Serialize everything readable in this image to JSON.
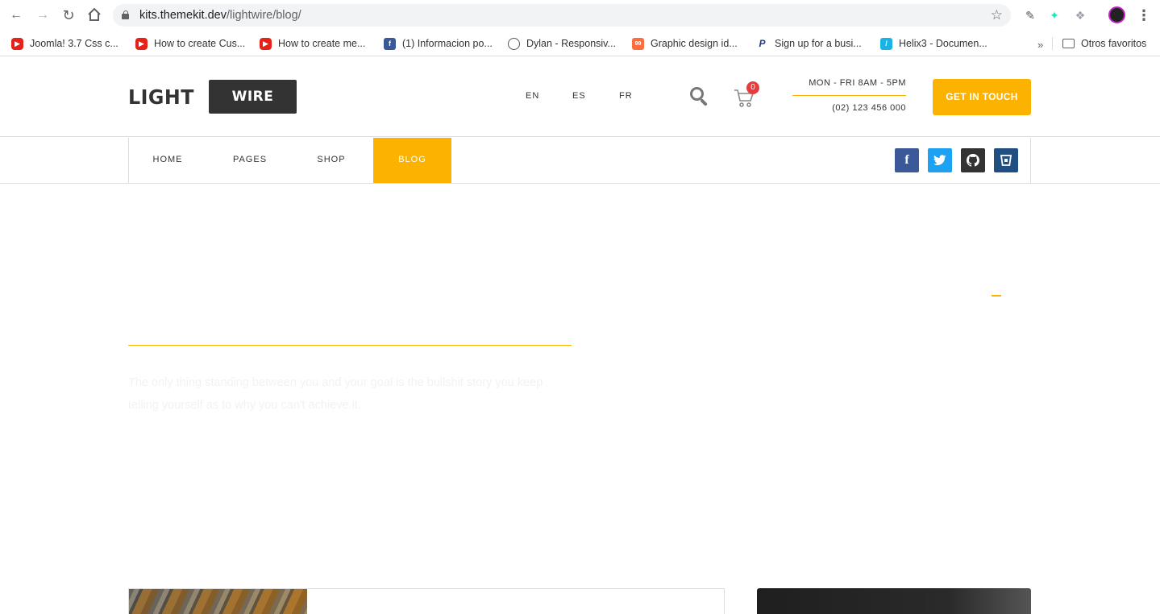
{
  "browser": {
    "url_host": "kits.themekit.dev",
    "url_path": "/lightwire/blog/",
    "bookmarks": [
      {
        "label": "Joomla! 3.7 Css c...",
        "icon": "youtube-icon"
      },
      {
        "label": "How to create Cus...",
        "icon": "youtube-icon"
      },
      {
        "label": "How to create me...",
        "icon": "youtube-icon"
      },
      {
        "label": "(1) Informacion po...",
        "icon": "facebook-icon"
      },
      {
        "label": "Dylan - Responsiv...",
        "icon": "globe-icon"
      },
      {
        "label": "Graphic design id...",
        "icon": "99designs-icon"
      },
      {
        "label": "Sign up for a busi...",
        "icon": "paypal-icon"
      },
      {
        "label": "Helix3 - Documen...",
        "icon": "helix-icon"
      }
    ],
    "bookmarks_more": "»",
    "other_bookmarks": "Otros favoritos"
  },
  "header": {
    "logo_left": "LIGHT",
    "logo_right": "WIRE",
    "languages": [
      "EN",
      "ES",
      "FR"
    ],
    "cart_count": "0",
    "hours": "MON - FRI 8AM - 5PM",
    "phone": "(02) 123 456 000",
    "cta_label": "GET IN TOUCH"
  },
  "nav": {
    "items": [
      "HOME",
      "PAGES",
      "SHOP",
      "BLOG"
    ],
    "active": "BLOG",
    "social": [
      "facebook-icon",
      "twitter-icon",
      "github-icon",
      "bitbucket-icon"
    ]
  },
  "hero": {
    "text": "The only thing standing between you and your goal is the bullshit story you keep telling yourself as to why you can't achieve it."
  },
  "colors": {
    "accent": "#fbb200",
    "dark": "#333333",
    "facebook": "#3b5998",
    "twitter": "#1da1f2",
    "github": "#333333",
    "bitbucket": "#205081",
    "badge": "#e63c3c"
  }
}
